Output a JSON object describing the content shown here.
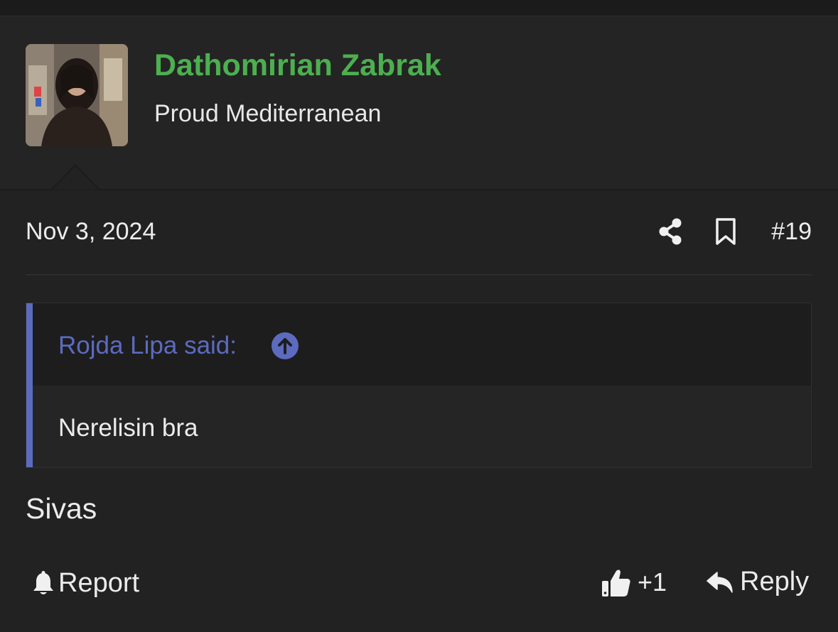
{
  "author": {
    "name": "Dathomirian Zabrak",
    "title": "Proud Mediterranean",
    "avatar_icon": "user-photo",
    "name_color": "#4caf50"
  },
  "post": {
    "date": "Nov 3, 2024",
    "number": "#19",
    "body": "Sivas"
  },
  "quote": {
    "author_label": "Rojda Lipa said:",
    "text": "Nerelisin bra",
    "accent_color": "#5c6bc0"
  },
  "actions": {
    "report_label": "Report",
    "like_count": "+1",
    "reply_label": "Reply"
  },
  "icons": {
    "share": "share-icon",
    "bookmark": "bookmark-icon",
    "quote_jump": "arrow-up-circle-icon",
    "report": "bell-icon",
    "like": "thumbs-up-icon",
    "reply": "reply-icon"
  }
}
